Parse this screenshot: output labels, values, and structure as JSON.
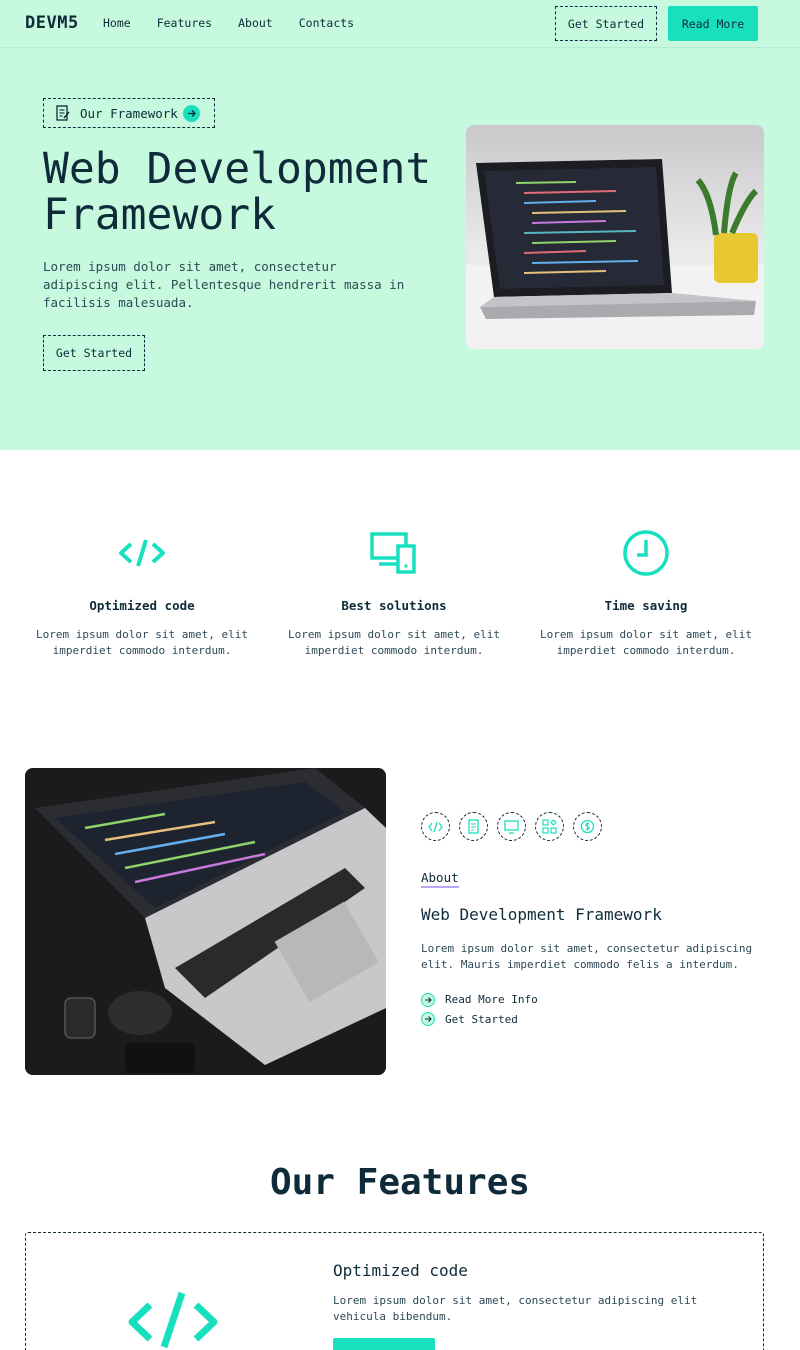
{
  "nav": {
    "brand": "DEVM5",
    "links": [
      "Home",
      "Features",
      "About",
      "Contacts"
    ],
    "get_started": "Get Started",
    "read_more": "Read More"
  },
  "hero": {
    "badge": "Our Framework",
    "title": "Web Development Framework",
    "text": "Lorem ipsum dolor sit amet, consectetur adipiscing elit. Pellentesque hendrerit massa in facilisis malesuada.",
    "button": "Get Started"
  },
  "features": [
    {
      "icon": "code-icon",
      "title": "Optimized code",
      "text": "Lorem ipsum dolor sit amet, elit imperdiet commodo interdum."
    },
    {
      "icon": "devices-icon",
      "title": "Best solutions",
      "text": "Lorem ipsum dolor sit amet, elit imperdiet commodo interdum."
    },
    {
      "icon": "clock-icon",
      "title": "Time saving",
      "text": "Lorem ipsum dolor sit amet, elit imperdiet commodo interdum."
    }
  ],
  "about": {
    "label": "About",
    "title": "Web Development Framework",
    "text": "Lorem ipsum dolor sit amet, consectetur adipiscing elit. Mauris imperdiet commodo felis a interdum.",
    "links": [
      "Read More Info",
      "Get Started"
    ],
    "icons": [
      "code-icon",
      "document-icon",
      "monitor-icon",
      "widgets-icon",
      "dollar-icon"
    ]
  },
  "our_features": {
    "title": "Our Features",
    "card": {
      "title": "Optimized code",
      "text": "Lorem ipsum dolor sit amet, consectetur adipiscing elit vehicula bibendum."
    }
  },
  "colors": {
    "mint": "#c6f9dd",
    "accent": "#18e0bf",
    "dark": "#0f2b3a",
    "underline": "#b8a9f5"
  }
}
